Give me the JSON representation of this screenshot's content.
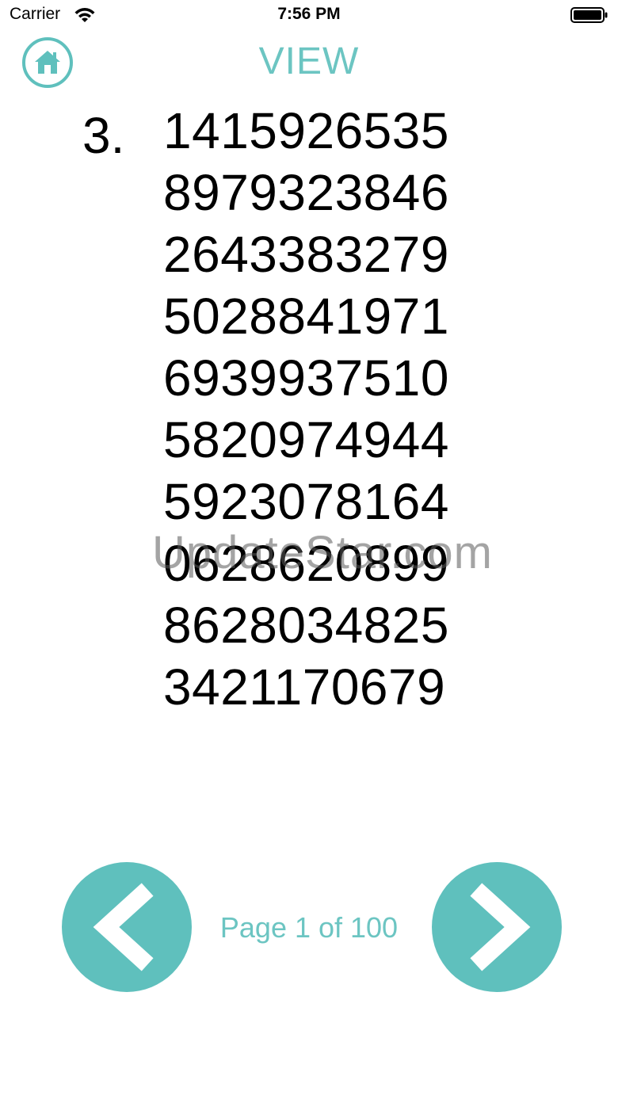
{
  "status_bar": {
    "carrier": "Carrier",
    "time": "7:56 PM",
    "wifi_icon": "wifi-icon",
    "battery_icon": "battery-icon"
  },
  "header": {
    "title": "VIEW",
    "home_icon": "home-icon"
  },
  "digits": {
    "prefix": "3.",
    "rows": [
      "1415926535",
      "8979323846",
      "2643383279",
      "5028841971",
      "6939937510",
      "5820974944",
      "5923078164",
      "0628620899",
      "8628034825",
      "3421170679"
    ]
  },
  "watermark": "UpdateStar.com",
  "pagination": {
    "label": "Page 1 of 100",
    "prev_icon": "chevron-left-icon",
    "next_icon": "chevron-right-icon"
  },
  "colors": {
    "accent": "#5fc0bd",
    "text": "#000000"
  }
}
